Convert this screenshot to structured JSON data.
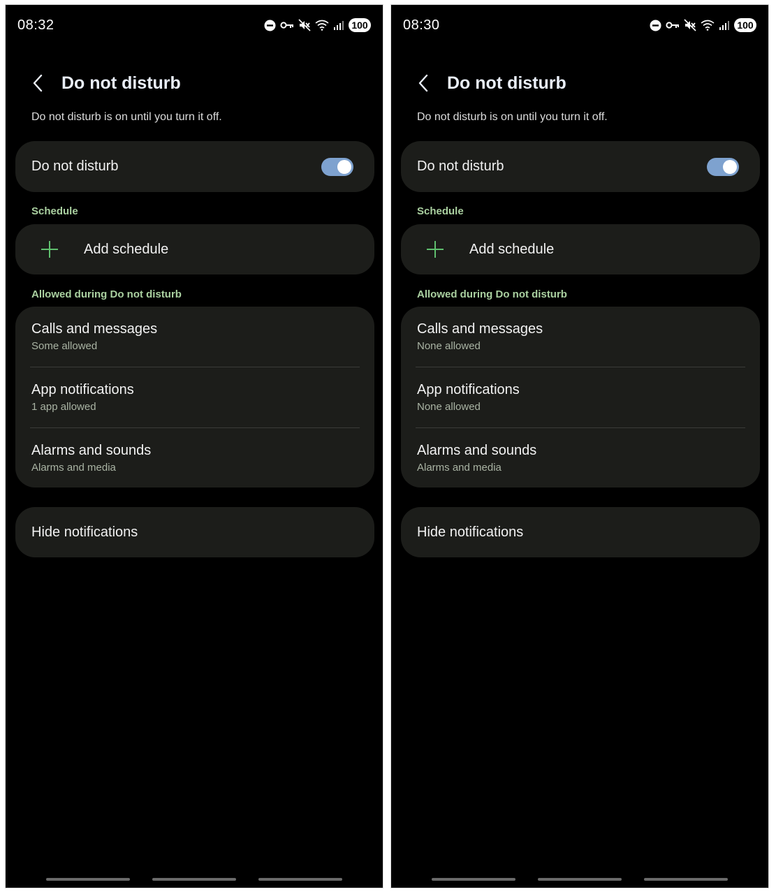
{
  "screens": [
    {
      "status": {
        "time": "08:32",
        "battery": "100"
      },
      "header": {
        "title": "Do not disturb"
      },
      "description": "Do not disturb is on until you turn it off.",
      "dnd_toggle": {
        "label": "Do not disturb",
        "state": "on"
      },
      "schedule": {
        "section_label": "Schedule",
        "add_label": "Add schedule"
      },
      "allowed": {
        "section_label": "Allowed during Do not disturb",
        "items": [
          {
            "title": "Calls and messages",
            "subtitle": "Some allowed"
          },
          {
            "title": "App notifications",
            "subtitle": "1 app allowed"
          },
          {
            "title": "Alarms and sounds",
            "subtitle": "Alarms and media"
          }
        ]
      },
      "hide_notifications": {
        "label": "Hide notifications"
      }
    },
    {
      "status": {
        "time": "08:30",
        "battery": "100"
      },
      "header": {
        "title": "Do not disturb"
      },
      "description": "Do not disturb is on until you turn it off.",
      "dnd_toggle": {
        "label": "Do not disturb",
        "state": "on"
      },
      "schedule": {
        "section_label": "Schedule",
        "add_label": "Add schedule"
      },
      "allowed": {
        "section_label": "Allowed during Do not disturb",
        "items": [
          {
            "title": "Calls and messages",
            "subtitle": "None allowed"
          },
          {
            "title": "App notifications",
            "subtitle": "None allowed"
          },
          {
            "title": "Alarms and sounds",
            "subtitle": "Alarms and media"
          }
        ]
      },
      "hide_notifications": {
        "label": "Hide notifications"
      }
    }
  ],
  "icons": {
    "status": [
      "dnd-icon",
      "vpn-key-icon",
      "mute-icon",
      "wifi-icon",
      "signal-icon"
    ],
    "back": "chevron-left-icon",
    "add": "plus-icon"
  },
  "colors": {
    "background": "#000000",
    "card": "#1c1d1a",
    "accent_green": "#5fbf6e",
    "section_label": "#aad0a0",
    "toggle_on": "#7ea2cf"
  }
}
